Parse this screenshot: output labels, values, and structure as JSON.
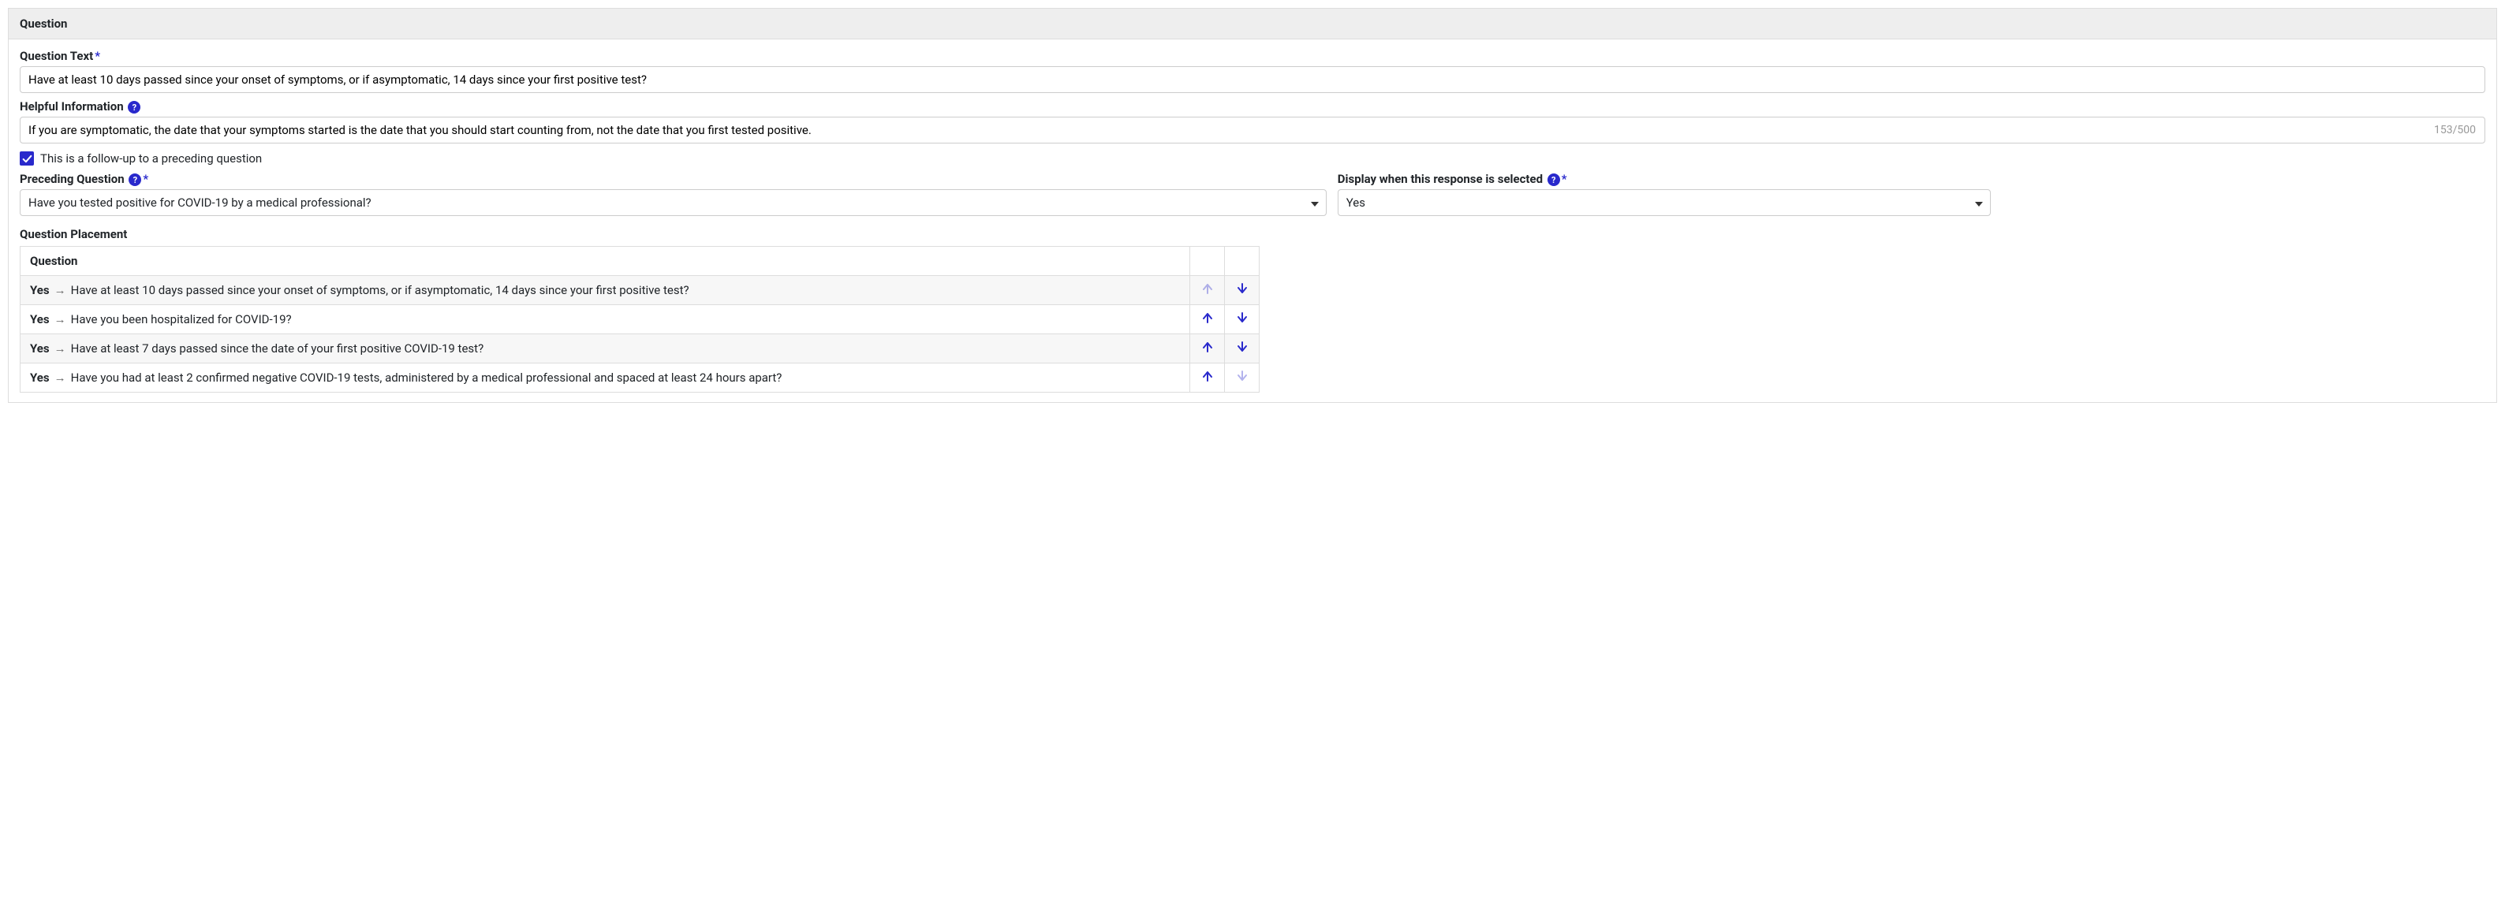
{
  "panel": {
    "title": "Question"
  },
  "questionText": {
    "label": "Question Text",
    "value": "Have at least 10 days passed since your onset of symptoms, or if asymptomatic, 14 days since your first positive test?"
  },
  "helpfulInfo": {
    "label": "Helpful Information",
    "value": "If you are symptomatic, the date that your symptoms started is the date that you should start counting from, not the date that you first tested positive.",
    "counter": "153/500"
  },
  "followUp": {
    "label": "This is a follow-up to a preceding question",
    "checked": true
  },
  "preceding": {
    "label": "Preceding Question",
    "selected": "Have you tested positive for COVID-19 by a medical professional?"
  },
  "displayWhen": {
    "label": "Display when this response is selected",
    "selected": "Yes"
  },
  "placement": {
    "label": "Question Placement",
    "header": "Question",
    "rows": [
      {
        "answer": "Yes",
        "text": "Have at least 10 days passed since your onset of symptoms, or if asymptomatic, 14 days since your first positive test?",
        "upDisabled": true,
        "downDisabled": false
      },
      {
        "answer": "Yes",
        "text": "Have you been hospitalized for COVID-19?",
        "upDisabled": false,
        "downDisabled": false
      },
      {
        "answer": "Yes",
        "text": "Have at least 7 days passed since the date of your first positive COVID-19 test?",
        "upDisabled": false,
        "downDisabled": false
      },
      {
        "answer": "Yes",
        "text": "Have you had at least 2 confirmed negative COVID-19 tests, administered by a medical professional and spaced at least 24 hours apart?",
        "upDisabled": false,
        "downDisabled": true
      }
    ]
  },
  "symbols": {
    "requiredMark": "*",
    "helpGlyph": "?",
    "arrowSep": "→"
  }
}
